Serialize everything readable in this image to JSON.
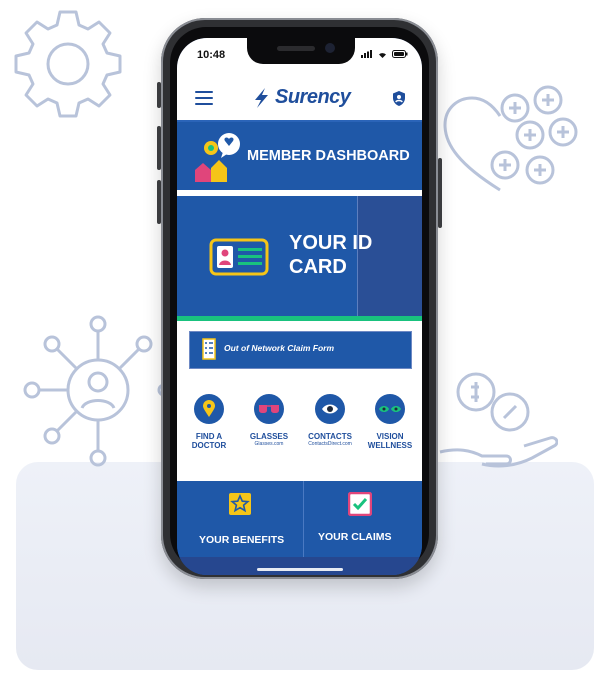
{
  "status_bar": {
    "time": "10:48"
  },
  "header": {
    "logo_text": "Surency"
  },
  "dashboard": {
    "title": "MEMBER DASHBOARD"
  },
  "id_card": {
    "label": "YOUR ID\nCARD"
  },
  "claim_form": {
    "label": "Out of Network Claim Form"
  },
  "quick_links": [
    {
      "label": "FIND A\nDOCTOR",
      "sub": ""
    },
    {
      "label": "GLASSES",
      "sub": "Glasses.com"
    },
    {
      "label": "CONTACTS",
      "sub": "ContactsDirect.com"
    },
    {
      "label": "VISION\nWELLNESS",
      "sub": ""
    }
  ],
  "bottom_tiles": [
    {
      "label": "YOUR BENEFITS"
    },
    {
      "label": "YOUR CLAIMS"
    }
  ],
  "colors": {
    "brand_blue": "#1f58a8",
    "accent_green": "#19c27e",
    "icon_yellow": "#f5c518",
    "icon_pink": "#e0457b"
  },
  "icons": [
    "gear-icon",
    "heart-plus-icon",
    "network-person-icon",
    "hand-money-icon",
    "menu-icon",
    "shield-user-icon",
    "id-card-icon",
    "checklist-icon",
    "location-pin-icon",
    "glasses-icon",
    "eye-icon",
    "eyes-icon",
    "star-badge-icon",
    "checkbox-icon"
  ]
}
